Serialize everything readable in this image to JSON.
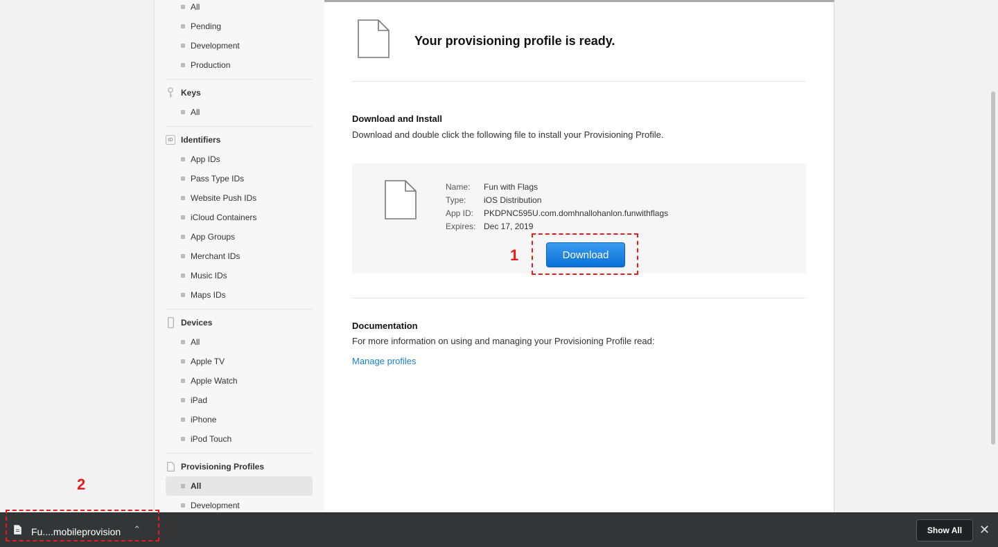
{
  "sidebar": {
    "certificates_items": [
      "All",
      "Pending",
      "Development",
      "Production"
    ],
    "keys": {
      "label": "Keys",
      "items": [
        "All"
      ]
    },
    "identifiers": {
      "label": "Identifiers",
      "icon_text": "ID",
      "items": [
        "App IDs",
        "Pass Type IDs",
        "Website Push IDs",
        "iCloud Containers",
        "App Groups",
        "Merchant IDs",
        "Music IDs",
        "Maps IDs"
      ]
    },
    "devices": {
      "label": "Devices",
      "items": [
        "All",
        "Apple TV",
        "Apple Watch",
        "iPad",
        "iPhone",
        "iPod Touch"
      ]
    },
    "profiles": {
      "label": "Provisioning Profiles",
      "items": [
        "All",
        "Development"
      ],
      "active_index": 0
    }
  },
  "main": {
    "ready_title": "Your provisioning profile is ready.",
    "download_title": "Download and Install",
    "download_text": "Download and double click the following file to install your Provisioning Profile.",
    "profile": {
      "name_label": "Name:",
      "name": "Fun with Flags",
      "type_label": "Type:",
      "type": "iOS Distribution",
      "appid_label": "App ID:",
      "appid": "PKDPNC595U.com.domhnallohanlon.funwithflags",
      "expires_label": "Expires:",
      "expires": "Dec 17, 2019"
    },
    "download_button": "Download",
    "doc_title": "Documentation",
    "doc_text": "For more information on using and managing your Provisioning Profile read:",
    "doc_link": "Manage profiles"
  },
  "annotations": {
    "one": "1",
    "two": "2"
  },
  "download_bar": {
    "file_name": "Fu....mobileprovision",
    "show_all": "Show All",
    "close": "✕"
  },
  "colors": {
    "accent": "#1a82d6",
    "annotation": "#e51b1b",
    "bar": "#333537"
  }
}
